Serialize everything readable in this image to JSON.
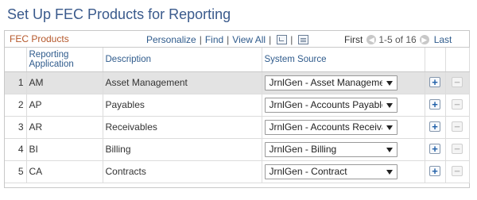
{
  "page": {
    "title": "Set Up FEC Products for Reporting"
  },
  "grid": {
    "title": "FEC Products",
    "tools": {
      "personalize": "Personalize",
      "find": "Find",
      "view_all": "View All",
      "separator": "|",
      "zoom_icon": "zoom-icon",
      "download_icon": "grid-download-icon"
    },
    "pager": {
      "first": "First",
      "range": "1-5 of 16",
      "last": "Last",
      "prev_icon": "chevron-left-icon",
      "next_icon": "chevron-right-icon"
    },
    "columns": {
      "reporting_application": "Reporting Application",
      "description": "Description",
      "system_source": "System Source"
    },
    "rows": [
      {
        "num": "1",
        "app": "AM",
        "description": "Asset Management",
        "source": "JrnlGen - Asset Management"
      },
      {
        "num": "2",
        "app": "AP",
        "description": "Payables",
        "source": "JrnlGen - Accounts Payable"
      },
      {
        "num": "3",
        "app": "AR",
        "description": "Receivables",
        "source": "JrnlGen - Accounts Receivable"
      },
      {
        "num": "4",
        "app": "BI",
        "description": "Billing",
        "source": "JrnlGen - Billing"
      },
      {
        "num": "5",
        "app": "CA",
        "description": "Contracts",
        "source": "JrnlGen - Contract"
      }
    ],
    "add_icon": "+",
    "delete_icon": "−"
  }
}
